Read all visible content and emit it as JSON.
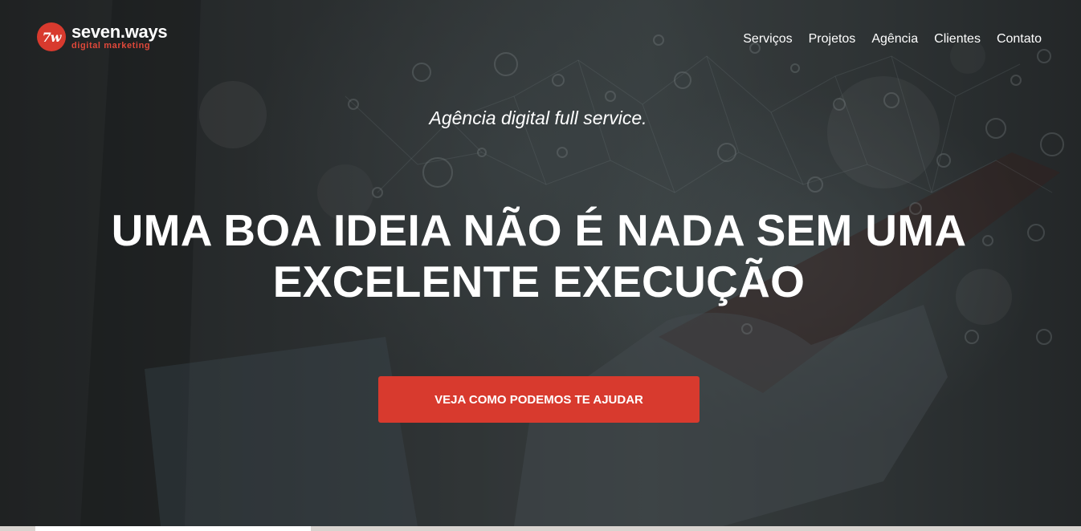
{
  "brand": {
    "mark": "7w",
    "name": "seven.ways",
    "tagline": "digital marketing",
    "accent_color": "#d83a2e"
  },
  "nav": {
    "items": [
      {
        "label": "Serviços"
      },
      {
        "label": "Projetos"
      },
      {
        "label": "Agência"
      },
      {
        "label": "Clientes"
      },
      {
        "label": "Contato"
      }
    ]
  },
  "hero": {
    "subtitle": "Agência digital full service.",
    "headline_line1": "UMA BOA IDEIA NÃO É NADA SEM UMA",
    "headline_line2": "EXCELENTE EXECUÇÃO",
    "cta_label": "VEJA COMO PODEMOS TE AJUDAR"
  }
}
